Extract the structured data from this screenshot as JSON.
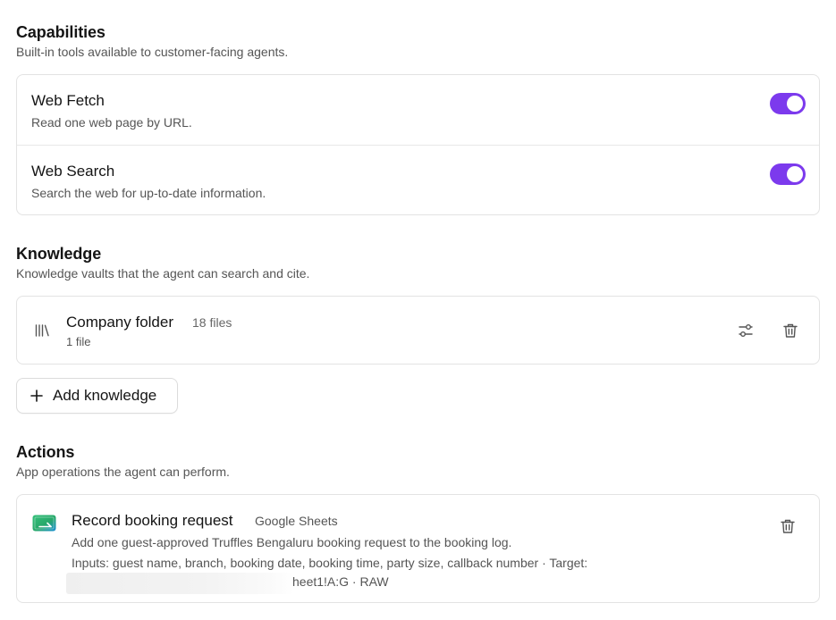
{
  "capabilities": {
    "title": "Capabilities",
    "description": "Built-in tools available to customer-facing agents.",
    "items": [
      {
        "name": "Web Fetch",
        "description": "Read one web page by URL.",
        "enabled": true
      },
      {
        "name": "Web Search",
        "description": "Search the web for up-to-date information.",
        "enabled": true
      }
    ]
  },
  "knowledge": {
    "title": "Knowledge",
    "description": "Knowledge vaults that the agent can search and cite.",
    "items": [
      {
        "name": "Company folder",
        "count": "18 files",
        "subtitle": "1 file",
        "icon": "library-icon"
      }
    ],
    "add_label": "Add knowledge"
  },
  "actions": {
    "title": "Actions",
    "description": "App operations the agent can perform.",
    "items": [
      {
        "name": "Record booking request",
        "app": "Google Sheets",
        "icon": "google-sheets-icon",
        "description": "Add one guest-approved Truffles Bengaluru booking request to the booking log.",
        "inputs": "Inputs: guest name, branch, booking date, booking time, party size, callback number · Target:",
        "target_visible": "heet1!A:G · RAW"
      }
    ]
  },
  "colors": {
    "toggle_on": "#7c3aed",
    "sheets_green": "#2bb673"
  }
}
